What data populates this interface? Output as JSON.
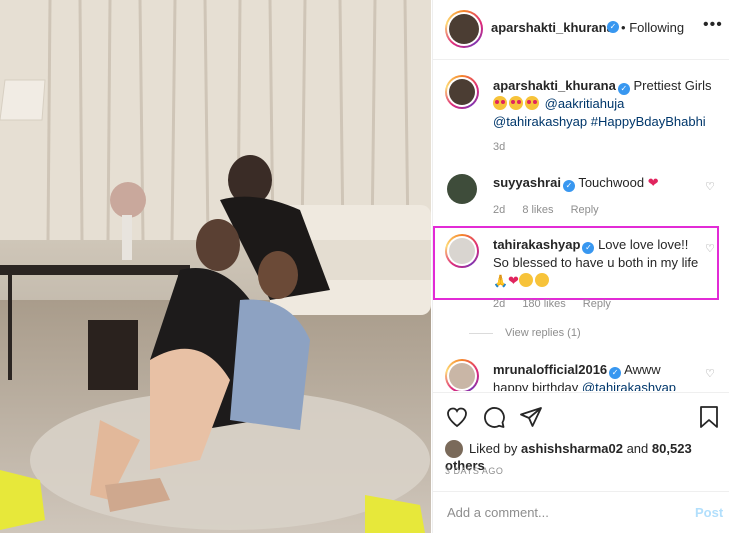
{
  "post": {
    "author": "aparshakti_khurana",
    "follow_status": "Following",
    "separator": "•",
    "more_label": "•••"
  },
  "caption": {
    "username": "aparshakti_khurana",
    "text": "Prettiest Girls",
    "mention1": "@aakritiahuja",
    "mention2": "@tahirakashyap",
    "hashtag": "#HappyBdayBhabhi",
    "time": "3d"
  },
  "comments": [
    {
      "username": "suyyashrai",
      "text": "Touchwood",
      "time": "2d",
      "likes": "8 likes",
      "reply": "Reply"
    },
    {
      "username": "tahirakashyap",
      "text_line1": "Love love love!!",
      "text_line2": "So blessed to have u both in my",
      "text_line3": "life",
      "time": "2d",
      "likes": "180 likes",
      "reply": "Reply",
      "view_replies": "View replies (1)"
    },
    {
      "username": "mrunalofficial2016",
      "text_line1": "Awww",
      "text_line2": "happy birthday",
      "mention": "@tahirakashyap"
    }
  ],
  "likes": {
    "prefix": "Liked by",
    "user": "ashishsharma02",
    "middle": "and",
    "others": "80,523 others"
  },
  "date": "3 DAYS AGO",
  "add_comment": {
    "placeholder": "Add a comment...",
    "post_label": "Post"
  },
  "colors": {
    "highlight": "#e22bd6",
    "verified": "#3897f0",
    "link": "#00376b",
    "post_disabled": "#b2dffc"
  },
  "icons": [
    "heart-icon",
    "comment-icon",
    "share-icon",
    "bookmark-icon",
    "verified-icon",
    "more-icon"
  ]
}
